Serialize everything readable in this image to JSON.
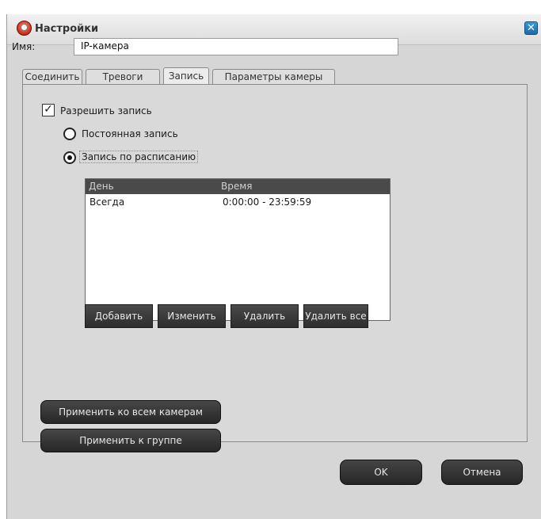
{
  "window": {
    "title": "Настройки",
    "close_label": "✕"
  },
  "name": {
    "label": "Имя:",
    "value": "IP-камера"
  },
  "tabs": [
    {
      "label": "Соединить"
    },
    {
      "label": "Тревоги"
    },
    {
      "label": "Запись",
      "active": true
    },
    {
      "label": "Параметры камеры"
    }
  ],
  "record": {
    "enable_label": "Разрешить запись",
    "enable_checked": true,
    "mode_continuous": "Постоянная запись",
    "mode_schedule": "Запись по расписанию",
    "selected_mode": "schedule"
  },
  "schedule_table": {
    "columns": {
      "day": "День",
      "time": "Время"
    },
    "rows": [
      {
        "day": "Всегда",
        "time": "0:00:00 - 23:59:59"
      }
    ]
  },
  "schedule_buttons": {
    "add": "Добавить",
    "edit": "Изменить",
    "delete": "Удалить",
    "delete_all": "Удалить все"
  },
  "apply": {
    "all_cameras": "Применить ко всем камерам",
    "group": "Применить к группе"
  },
  "dialog": {
    "ok": "OK",
    "cancel": "Отмена"
  }
}
